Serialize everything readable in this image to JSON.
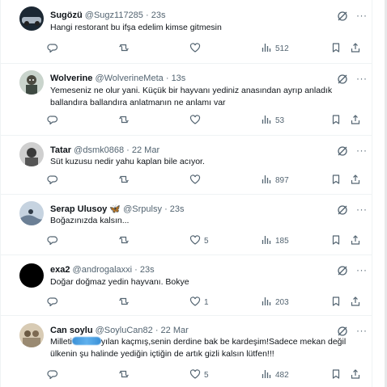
{
  "tweets": [
    {
      "name": "Sugözü",
      "handle": "@Sugz117285",
      "time": "23s",
      "text": "Hangi restorant bu ifşa edelim kimse gitmesin",
      "replies": "",
      "retweets": "",
      "likes": "",
      "views": "512",
      "avatar_colors": [
        "#6b7b8c",
        "#2a3a4a"
      ]
    },
    {
      "name": "Wolverine",
      "handle": "@WolverineMeta",
      "time": "13s",
      "text": "Yemeseniz ne olur yani. Küçük bir hayvanı yediniz anasından ayrıp anladık ballandıra ballandıra anlatmanın ne anlamı var",
      "replies": "",
      "retweets": "",
      "likes": "",
      "views": "53",
      "avatar_colors": [
        "#8aa090",
        "#4a5a50"
      ]
    },
    {
      "name": "Tatar",
      "handle": "@dsmk0868",
      "time": "22 Mar",
      "text": "Süt kuzusu nedir yahu kaplan bile acıyor.",
      "replies": "",
      "retweets": "",
      "likes": "",
      "views": "897",
      "avatar_colors": [
        "#9a9a9a",
        "#3a3a3a"
      ]
    },
    {
      "name": "Serap Ulusoy",
      "name_emoji": "🦋",
      "handle": "@Srpulsy",
      "time": "23s",
      "text": "Boğazınızda kalsın...",
      "replies": "",
      "retweets": "",
      "likes": "5",
      "views": "185",
      "avatar_colors": [
        "#b8c6d6",
        "#5a6e86"
      ]
    },
    {
      "name": "exa2",
      "handle": "@androgalaxxi",
      "time": "23s",
      "text": "Doğar doğmaz yedin hayvanı. Bokye",
      "replies": "",
      "retweets": "",
      "likes": "1",
      "views": "203",
      "avatar_colors": [
        "#000000",
        "#000000"
      ]
    },
    {
      "name": "Can soylu",
      "handle": "@SoyluCan82",
      "time": "22 Mar",
      "text_before": "Milleti",
      "text": "yılan kaçmış,senin derdine bak be kardeşim!Sadece mekan değil ülkenin şu halinde yediğin içtiğin de artık gizli kalsın lütfen!!!",
      "replies": "",
      "retweets": "",
      "likes": "5",
      "views": "482",
      "avatar_colors": [
        "#c8b8a0",
        "#7a6a58"
      ]
    }
  ],
  "icons": {
    "reply": "reply-icon",
    "retweet": "retweet-icon",
    "like": "heart-icon",
    "views": "views-icon",
    "bookmark": "bookmark-icon",
    "share": "share-icon",
    "grok": "grok-icon",
    "more": "more-icon"
  },
  "colors": {
    "text": "#0f1419",
    "secondary": "#536471",
    "border": "#eff3f4"
  }
}
